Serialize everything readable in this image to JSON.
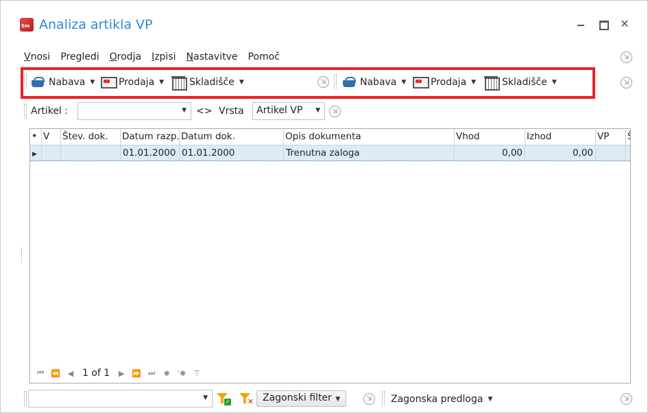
{
  "window": {
    "title": "Analiza artikla VP",
    "controls": {
      "close_glyph": "✕"
    }
  },
  "menu": {
    "items": [
      {
        "label": "Vnosi",
        "underline": "V",
        "rest": "nosi"
      },
      {
        "label": "Pregledi"
      },
      {
        "label": "Orodja",
        "underline": "O",
        "rest": "rodja"
      },
      {
        "label": "Izpisi",
        "underline": "I",
        "rest": "zpisi"
      },
      {
        "label": "Nastavitve",
        "underline": "N",
        "rest": "astavitve"
      },
      {
        "label": "Pomoč"
      }
    ],
    "overflow_glyph": "⇲"
  },
  "toolbar": {
    "group1": [
      {
        "label": "Nabava",
        "icon": "basket-icon"
      },
      {
        "label": "Prodaja",
        "icon": "monitor-icon"
      },
      {
        "label": "Skladišče",
        "icon": "warehouse-icon"
      }
    ],
    "group2": [
      {
        "label": "Nabava",
        "icon": "basket-icon"
      },
      {
        "label": "Prodaja",
        "icon": "monitor-icon"
      },
      {
        "label": "Skladišče",
        "icon": "warehouse-icon"
      }
    ],
    "highlight_color": "#e8212a"
  },
  "filter": {
    "artikel_label": "Artikel :",
    "artikel_value": "",
    "swap_symbol": "<>",
    "vrsta_label": "Vrsta",
    "vrsta_value": "Artikel VP"
  },
  "grid": {
    "columns": [
      "⁕",
      "V",
      "Štev. dok.",
      "Datum razp.",
      "Datum dok.",
      "Opis dokumenta",
      "Vhod",
      "Izhod",
      "VP",
      "Š"
    ],
    "rows": [
      {
        "indicator": "▶",
        "v": "",
        "stev_dok": "",
        "datum_razp": "01.01.2000",
        "datum_dok": "01.01.2000",
        "opis": "Trenutna zaloga",
        "vhod": "0,00",
        "izhod": "0,00",
        "vp": ""
      }
    ],
    "selected_row_color": "#ddebf7",
    "navigator": {
      "page_text": "1 of 1",
      "first": "⏮",
      "prev_page": "⏪",
      "prev": "◀",
      "next": "▶",
      "next_page": "⏩",
      "last": "⏭",
      "add": "✱",
      "add_copy": "'✱",
      "filter": "⊤"
    }
  },
  "bottom": {
    "filter_combo_value": "",
    "zagonski_filter_label": "Zagonski filter",
    "zagonska_predloga_label": "Zagonska predloga"
  }
}
